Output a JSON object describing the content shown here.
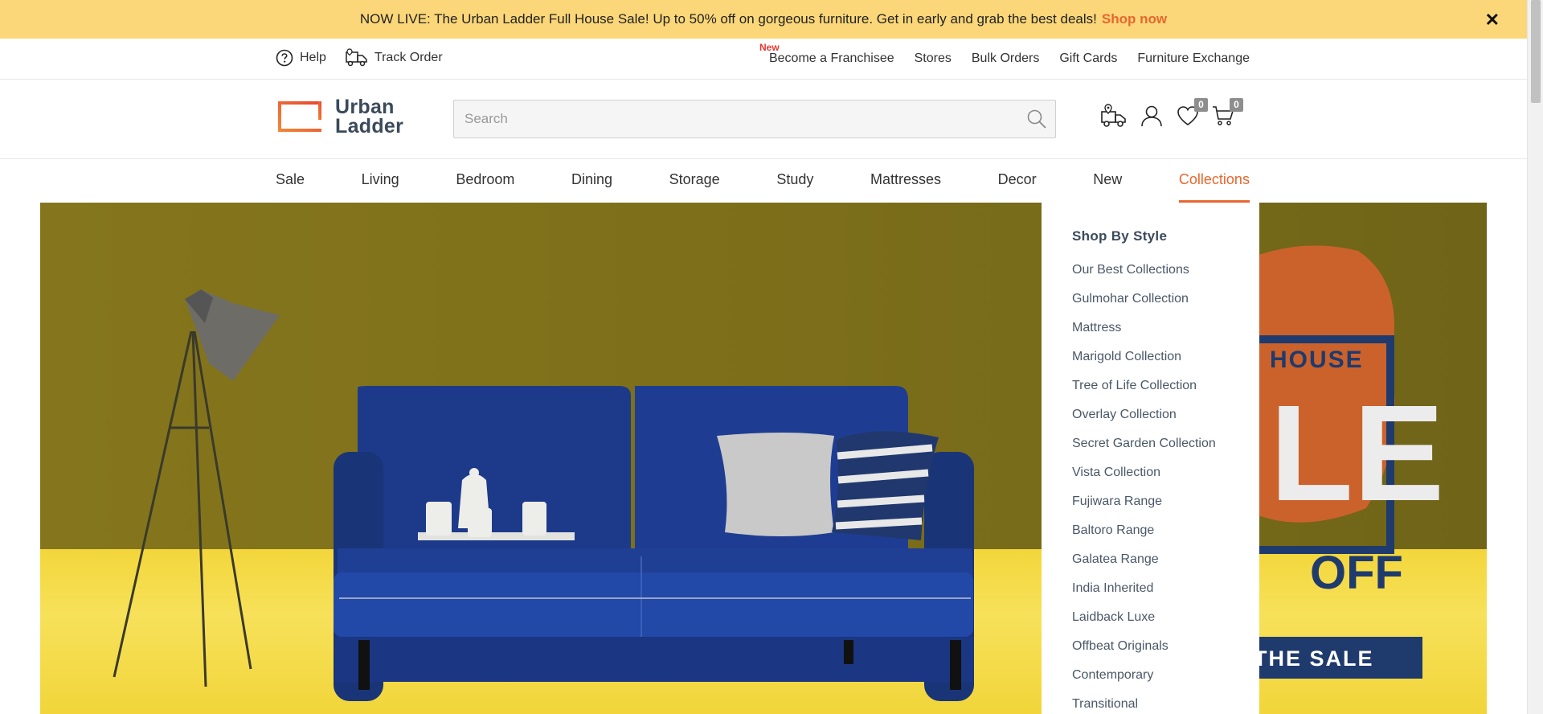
{
  "announcement": {
    "text": "NOW LIVE: The Urban Ladder Full House Sale! Up to 50% off on gorgeous furniture. Get in early and grab the best deals!",
    "link": "Shop now",
    "close": "✕"
  },
  "utility": {
    "help": "Help",
    "track_order": "Track Order",
    "links": [
      "Become a Franchisee",
      "Stores",
      "Bulk Orders",
      "Gift Cards",
      "Furniture Exchange"
    ],
    "new_badge": "New"
  },
  "header": {
    "logo_line1": "Urban",
    "logo_line2": "Ladder",
    "search_placeholder": "Search",
    "wishlist_count": "0",
    "cart_count": "0"
  },
  "nav": {
    "items": [
      "Sale",
      "Living",
      "Bedroom",
      "Dining",
      "Storage",
      "Study",
      "Mattresses",
      "Decor",
      "New",
      "Collections"
    ],
    "active": "Collections"
  },
  "dropdown": {
    "title": "Shop By Style",
    "items": [
      "Our Best Collections",
      "Gulmohar Collection",
      "Mattress",
      "Marigold Collection",
      "Tree of Life Collection",
      "Overlay Collection",
      "Secret Garden Collection",
      "Vista Collection",
      "Fujiwara Range",
      "Baltoro Range",
      "Galatea Range",
      "India Inherited",
      "Laidback Luxe",
      "Offbeat Originals",
      "Contemporary",
      "Transitional"
    ]
  },
  "hero": {
    "promo_house": "HOUSE",
    "promo_le": "LE",
    "promo_off": "OFF",
    "promo_cta": "THE SALE"
  },
  "colors": {
    "accent": "#e8662f",
    "announcement_bg": "#fbd779",
    "text_dark": "#333333",
    "logo_text": "#3a4a5a"
  }
}
